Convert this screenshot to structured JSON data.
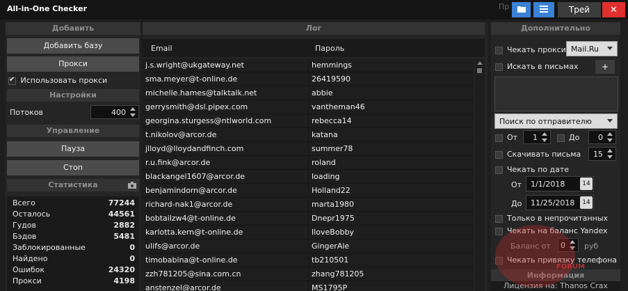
{
  "window": {
    "title": "All-in-One Checker",
    "ghost_text": "Пр",
    "tray_label": "Трей",
    "close_label": "✕"
  },
  "left": {
    "add_header": "Добавить",
    "add_base": "Добавить базу",
    "proxy_btn": "Прокси",
    "use_proxy": "Использовать прокси",
    "settings_header": "Настройки",
    "threads_label": "Потоков",
    "threads_value": "400",
    "control_header": "Управление",
    "pause_btn": "Пауза",
    "stop_btn": "Стоп",
    "stats_header": "Статистика",
    "stats": [
      {
        "label": "Всего",
        "value": "77244"
      },
      {
        "label": "Осталось",
        "value": "44561"
      },
      {
        "label": "Гудов",
        "value": "2882"
      },
      {
        "label": "Бэдов",
        "value": "5481"
      },
      {
        "label": "Заблокированные",
        "value": "0"
      },
      {
        "label": "Найдено",
        "value": "0"
      },
      {
        "label": "Ошибок",
        "value": "24320"
      },
      {
        "label": "Прокси",
        "value": "4198"
      }
    ]
  },
  "log": {
    "header": "Лог",
    "col_email": "Email",
    "col_password": "Пароль",
    "rows": [
      {
        "email": "j.s.wright@ukgateway.net",
        "password": "hemmings"
      },
      {
        "email": "sma.meyer@t-online.de",
        "password": "26419590"
      },
      {
        "email": "michelle.hames@talktalk.net",
        "password": "abbie"
      },
      {
        "email": "gerrysmith@dsl.pipex.com",
        "password": "vantheman46"
      },
      {
        "email": "georgina.sturgess@ntlworld.com",
        "password": "rebecca14"
      },
      {
        "email": "t.nikolov@arcor.de",
        "password": "katana"
      },
      {
        "email": "jlloyd@lloydandfinch.com",
        "password": "summer78"
      },
      {
        "email": "r.u.fink@arcor.de",
        "password": "roland"
      },
      {
        "email": "blackangel1607@arcor.de",
        "password": "loading"
      },
      {
        "email": "benjamindorn@arcor.de",
        "password": "Holland22"
      },
      {
        "email": "richard-nak1@arcor.de",
        "password": "marta1980"
      },
      {
        "email": "bobtailzw4@t-online.de",
        "password": "Dnepr1975"
      },
      {
        "email": "karlotta.kern@t-online.de",
        "password": "IloveBobby"
      },
      {
        "email": "ulifs@arcor.de",
        "password": "GingerAle"
      },
      {
        "email": "timobabina@t-online.de",
        "password": "tb210501"
      },
      {
        "email": "zzh781205@sina.com.cn",
        "password": "zhang781205"
      },
      {
        "email": "anstenzel@arcor.de",
        "password": "MS1795P"
      }
    ]
  },
  "right": {
    "header": "Дополнительно",
    "check_proxy": "Чекать прокси",
    "provider": "Mail.Ru",
    "search_letters": "Искать в письмах",
    "plus": "+",
    "search_mode": "Поиск по отправителю",
    "from_label": "От",
    "from_value": "1",
    "to_label": "До",
    "to_value": "0",
    "download_letters": "Скачивать письма",
    "download_value": "15",
    "check_by_date": "Чекать по дате",
    "date_from_label": "От",
    "date_from": "1/1/2018",
    "date_to_label": "До",
    "date_to": "11/25/2018",
    "only_unread": "Только в непрочитанных",
    "yandex_balance": "Чекать на баланс Yandex",
    "balance_from_label": "Баланс от",
    "balance_value": "0",
    "balance_unit": "руб",
    "phone_binding": "Чекать привязку телефона",
    "info_header": "Информация",
    "license": "Лицензия на: Thanos Crax"
  },
  "watermark": {
    "text": "FORUM"
  },
  "colors": {
    "accent_blue": "#3a82d6",
    "close_red": "#e0302e",
    "panel_bg": "#252525"
  }
}
